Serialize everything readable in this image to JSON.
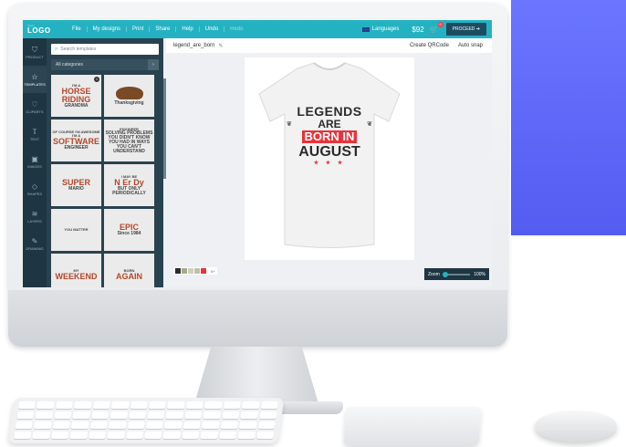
{
  "app": {
    "logo_sub": "Your",
    "logo": "LOGO",
    "menu": [
      "File",
      "My designs",
      "Print",
      "Share",
      "Help",
      "Undo",
      "Redo"
    ],
    "languages": "Languages",
    "price": "$92",
    "cart_count": "0",
    "proceed": "PROCEED"
  },
  "sidebar": {
    "items": [
      {
        "label": "PRODUCT",
        "icon": "tshirt-icon",
        "glyph": "⛉"
      },
      {
        "label": "TEMPLATES",
        "icon": "star-icon",
        "glyph": "☆"
      },
      {
        "label": "CLIPARTS",
        "icon": "heart-icon",
        "glyph": "♡"
      },
      {
        "label": "TEXT",
        "icon": "text-icon",
        "glyph": "Ⲧ"
      },
      {
        "label": "IMAGES",
        "icon": "image-icon",
        "glyph": "▣"
      },
      {
        "label": "SHAPES",
        "icon": "diamond-icon",
        "glyph": "◇"
      },
      {
        "label": "LAYERS",
        "icon": "layers-icon",
        "glyph": "≋"
      },
      {
        "label": "DRAWING",
        "icon": "pencil-icon",
        "glyph": "✎"
      }
    ]
  },
  "templates": {
    "search_placeholder": "Search templates",
    "category": "All categories",
    "items": [
      {
        "l1": "I'M A",
        "l2": "HORSE RIDING",
        "l3": "GRANDMA"
      },
      {
        "l1": "",
        "l2": "",
        "l3": "Thanksgiving"
      },
      {
        "l1": "OF COURSE I'M AWESOME I'M A",
        "l2": "SOFTWARE",
        "l3": "ENGINEER"
      },
      {
        "l1": "ENGINEER",
        "l2": "",
        "l3": "SOLVING PROBLEMS YOU DIDN'T KNOW YOU HAD IN WAYS YOU CAN'T UNDERSTAND"
      },
      {
        "l1": "",
        "l2": "SUPER",
        "l3": "MARIO"
      },
      {
        "l1": "I MAY BE",
        "l2": "N Er Dy",
        "l3": "BUT ONLY PERIODICALLY"
      },
      {
        "l1": "YOU MATTER",
        "l2": "",
        "l3": ""
      },
      {
        "l1": "",
        "l2": "EPIC",
        "l3": "Since 1984"
      },
      {
        "l1": "MY",
        "l2": "WEEKEND",
        "l3": ""
      },
      {
        "l1": "BORN",
        "l2": "AGAIN",
        "l3": ""
      }
    ]
  },
  "document": {
    "name": "legend_are_born",
    "create_qr": "Create QRCode",
    "auto_snap": "Auto snap"
  },
  "design": {
    "line1": "LEGENDS",
    "line2": "ARE",
    "line3": "BORN IN",
    "line4": "AUGUST",
    "stars": "★ ★ ★"
  },
  "palette": {
    "colors": [
      "#2b2b2b",
      "#a7a98a",
      "#cfcfbe",
      "#bfbfb0",
      "#e8333b"
    ],
    "more": "5+"
  },
  "zoom": {
    "label": "Zoom",
    "value": "100%"
  }
}
